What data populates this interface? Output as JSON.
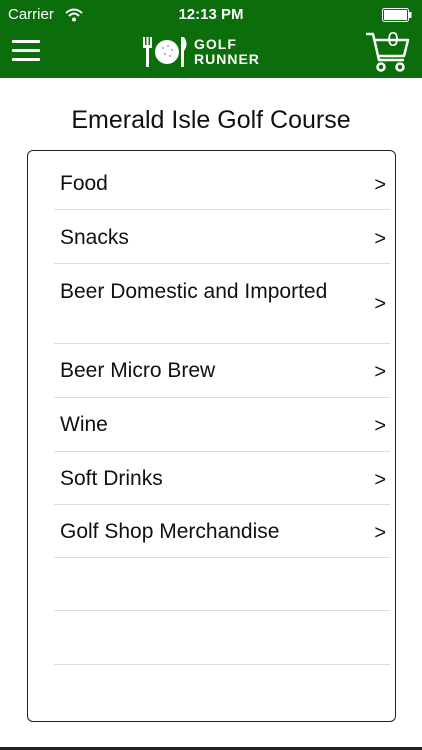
{
  "status_bar": {
    "carrier": "Carrier",
    "time": "12:13 PM"
  },
  "header": {
    "background_color": "#0b6e0b",
    "menu_icon": "hamburger-menu-icon",
    "logo_icon": "fork-knife-golf-ball-icon",
    "logo_line1": "GOLF",
    "logo_line2": "RUNNER",
    "cart_icon": "shopping-cart-icon",
    "cart_count": "0"
  },
  "course": {
    "title": "Emerald Isle Golf Course"
  },
  "categories": [
    {
      "label": "Food",
      "chevron": ">"
    },
    {
      "label": "Snacks",
      "chevron": ">"
    },
    {
      "label": "Beer Domestic and Imported",
      "chevron": ">"
    },
    {
      "label": "Beer Micro Brew",
      "chevron": ">"
    },
    {
      "label": "Wine",
      "chevron": ">"
    },
    {
      "label": "Soft Drinks",
      "chevron": ">"
    },
    {
      "label": "Golf Shop Merchandise",
      "chevron": ">"
    }
  ]
}
